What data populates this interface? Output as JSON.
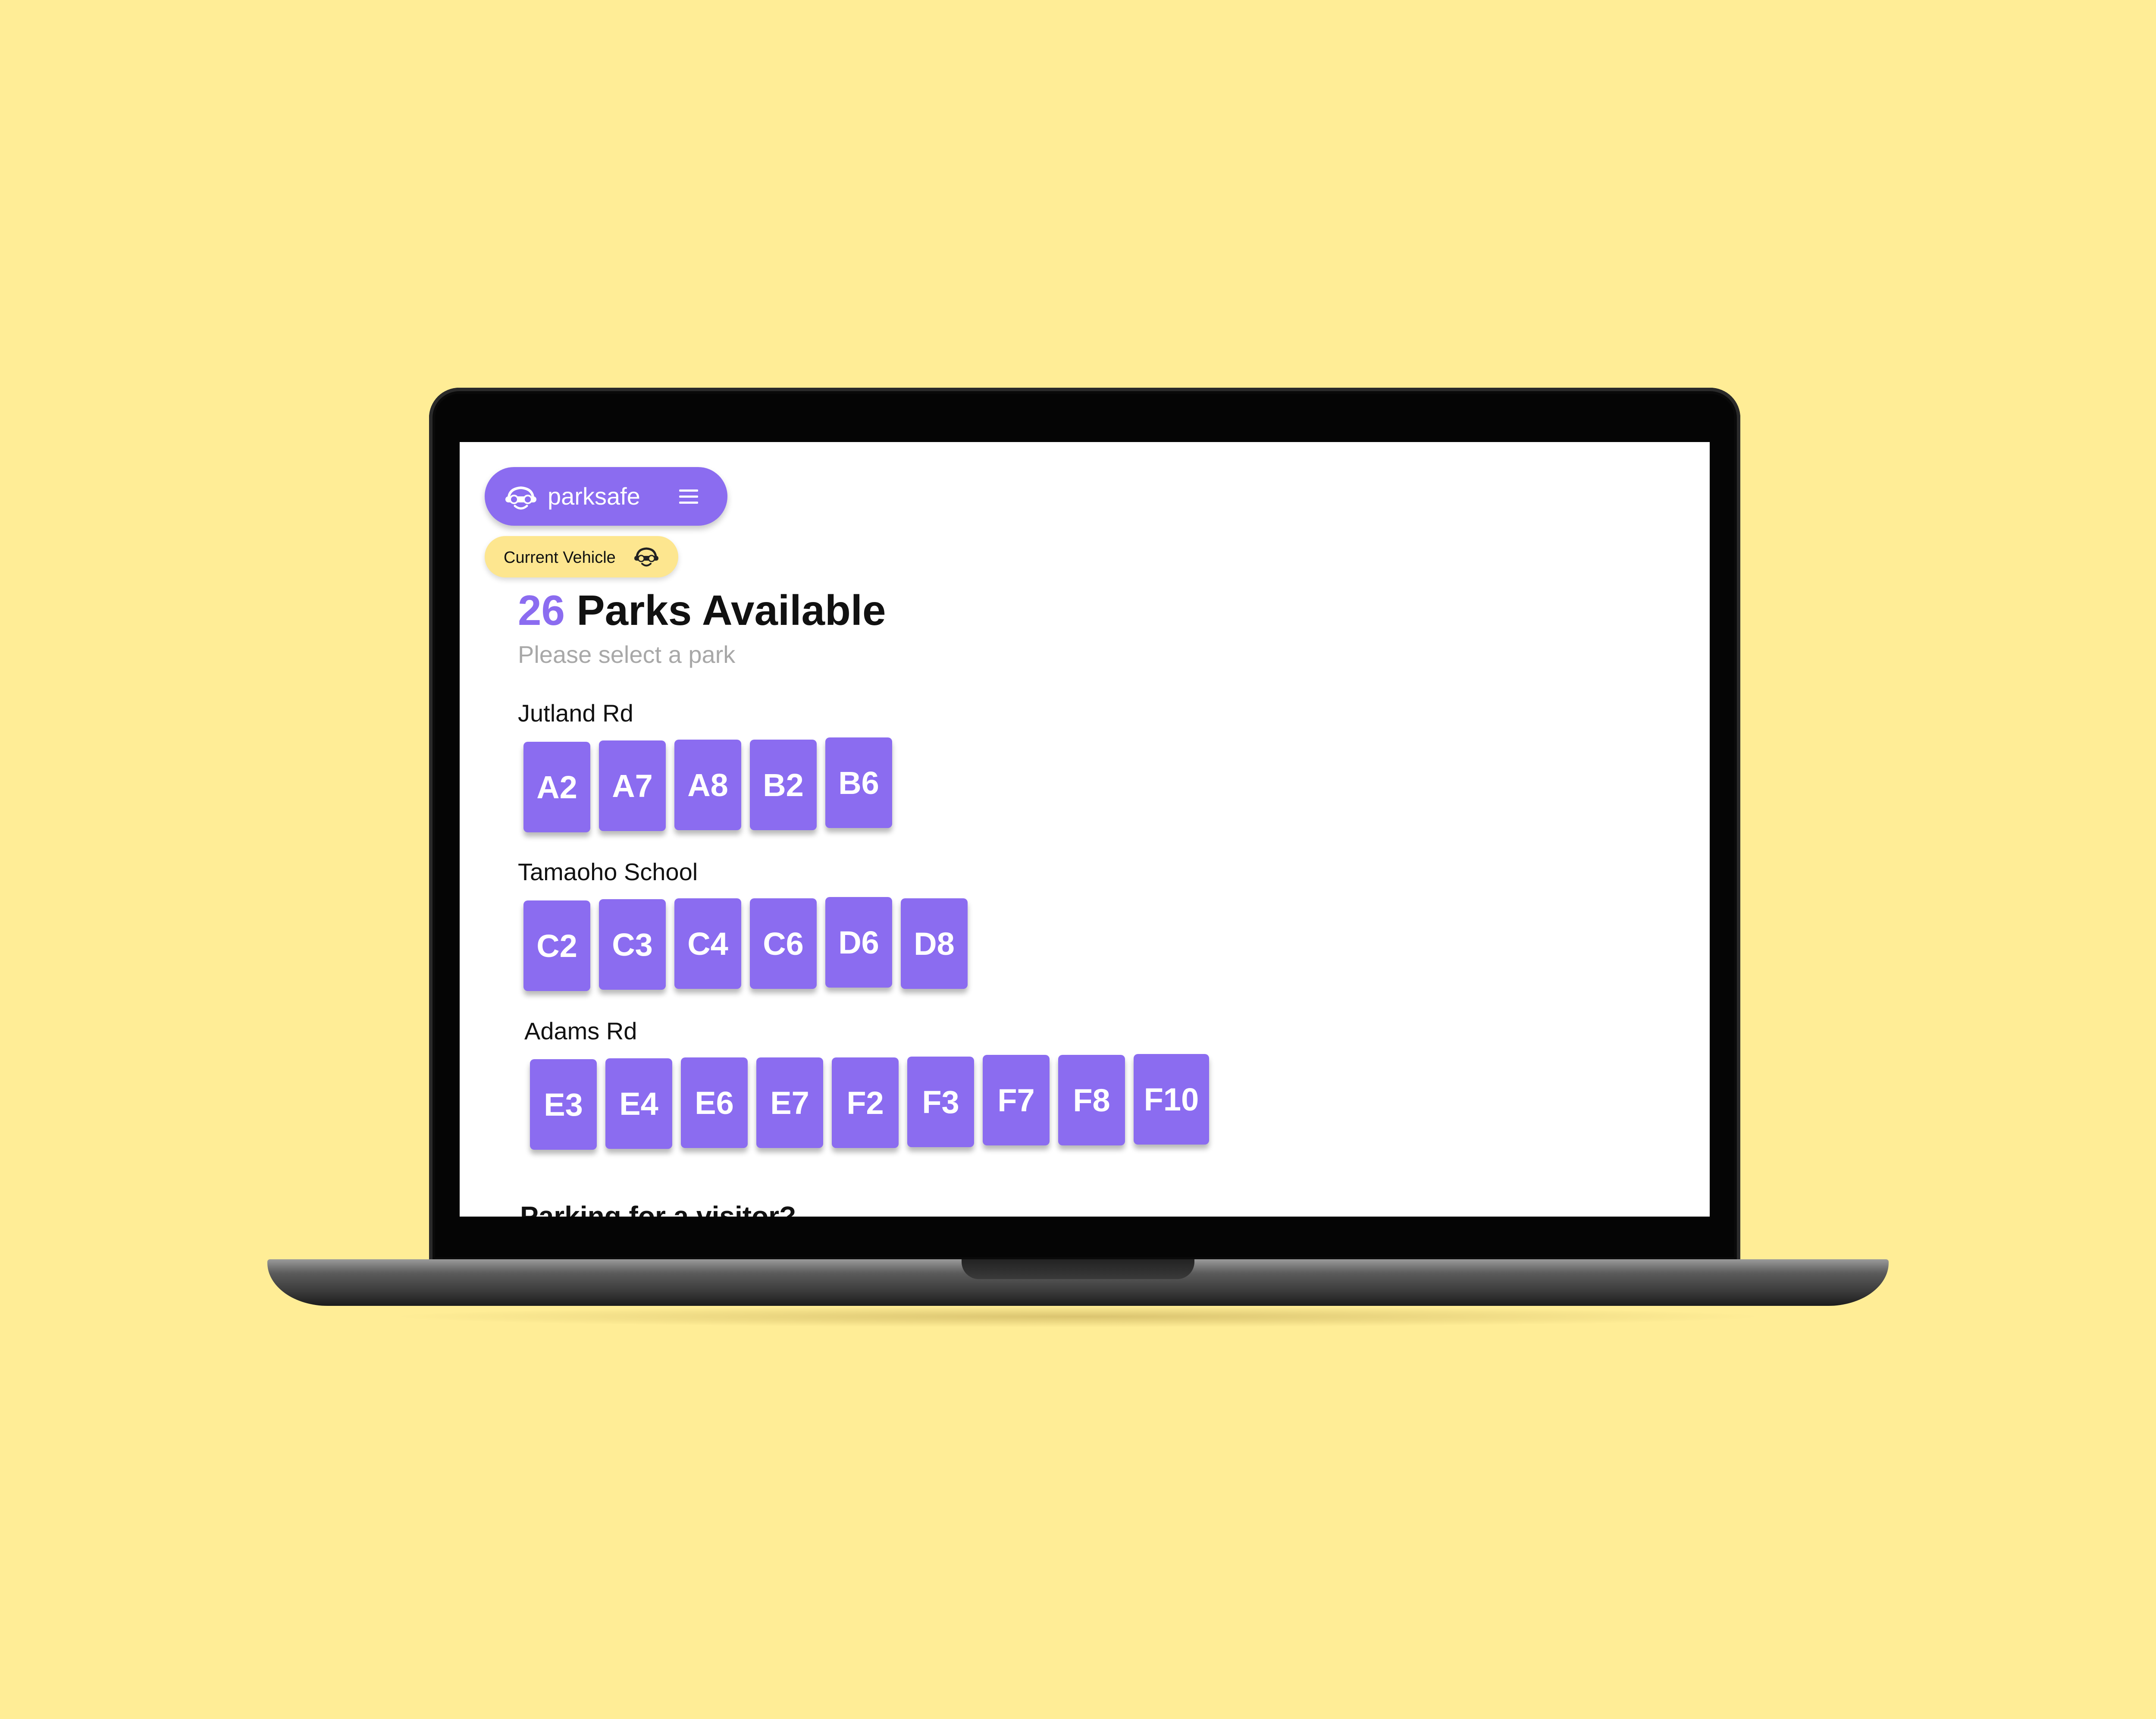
{
  "brand": {
    "name": "parksafe",
    "logo_icon": "car-face-icon",
    "menu_icon": "hamburger-menu-icon"
  },
  "vehicle": {
    "label": "Current Vehicle",
    "icon": "car-face-icon"
  },
  "heading": {
    "count": "26",
    "text": " Parks Available",
    "subtitle": "Please select a park"
  },
  "locations": [
    {
      "name": "Jutland Rd",
      "parks": [
        "A2",
        "A7",
        "A8",
        "B2",
        "B6"
      ]
    },
    {
      "name": "Tamaoho School",
      "parks": [
        "C2",
        "C3",
        "C4",
        "C6",
        "D6",
        "D8"
      ]
    },
    {
      "name": "Adams Rd",
      "parks": [
        "E3",
        "E4",
        "E6",
        "E7",
        "F2",
        "F3",
        "F7",
        "F8",
        "F10"
      ]
    }
  ],
  "footer": {
    "partial_heading": "Parking for a visitor?"
  },
  "colors": {
    "background": "#ffed96",
    "accent": "#8b6cf0",
    "vehicle_pill": "#fde68f",
    "subtitle": "#a8a8a8"
  }
}
